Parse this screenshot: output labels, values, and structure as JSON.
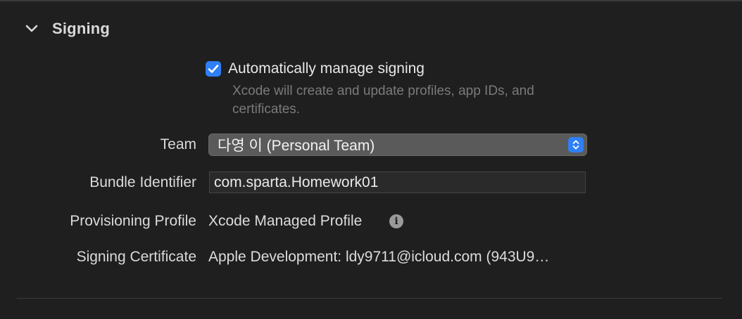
{
  "section": {
    "title": "Signing",
    "chevron_icon": "chevron-down-icon"
  },
  "auto_manage": {
    "checked": true,
    "label": "Automatically manage signing",
    "description": "Xcode will create and update profiles, app IDs, and certificates."
  },
  "team": {
    "label": "Team",
    "selected": "다영 이 (Personal Team)",
    "stepper_icon": "up-down-chevron-icon"
  },
  "bundle": {
    "label": "Bundle Identifier",
    "value": "com.sparta.Homework01"
  },
  "provisioning": {
    "label": "Provisioning Profile",
    "value": "Xcode Managed Profile",
    "info_icon": "info-icon"
  },
  "certificate": {
    "label": "Signing Certificate",
    "value": "Apple Development: ldy9711@icloud.com (943U9…"
  },
  "colors": {
    "background": "#1f1f1f",
    "accent": "#2f7ff5",
    "secondary_text": "#7a7a7a"
  }
}
